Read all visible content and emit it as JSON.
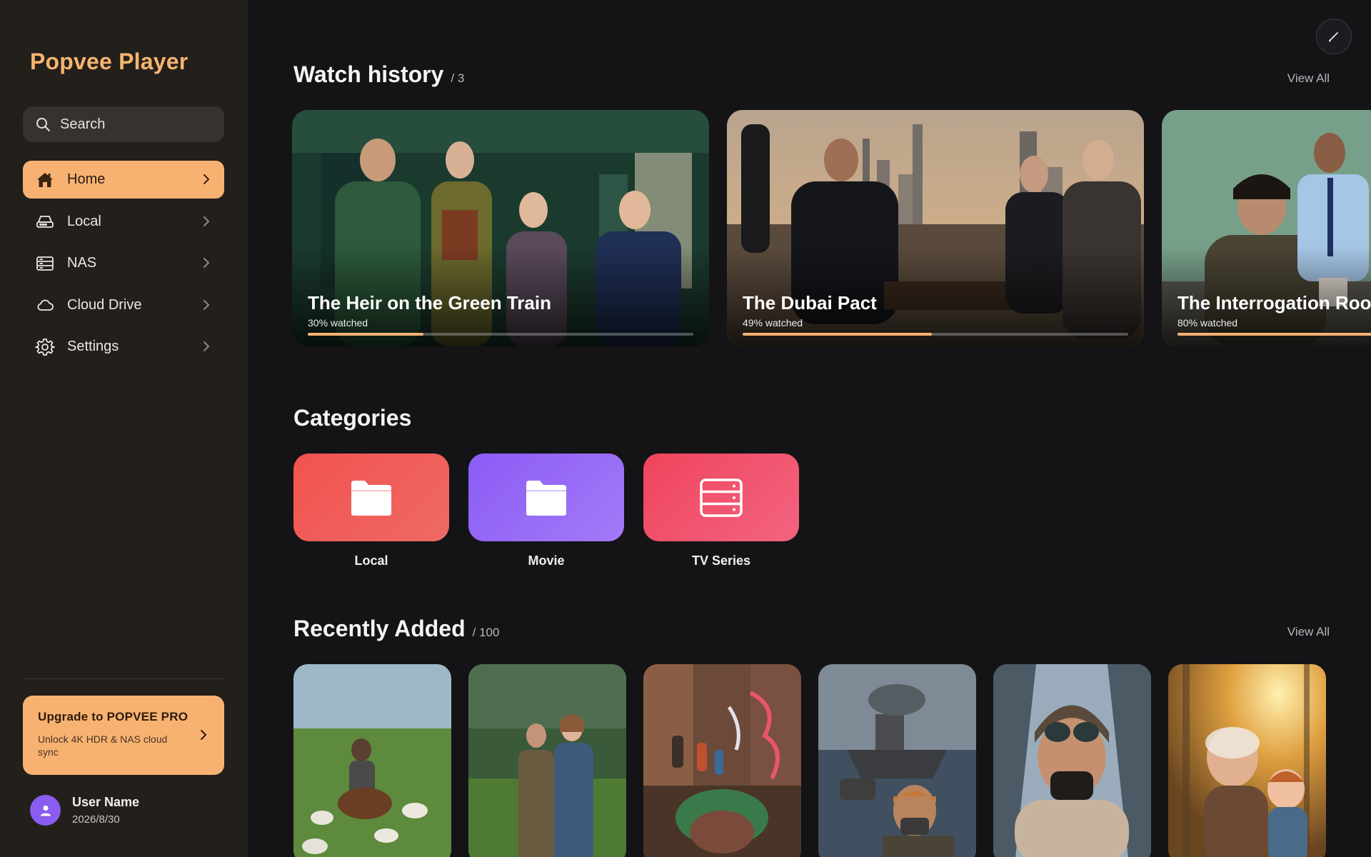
{
  "app": {
    "title": "Popvee Player"
  },
  "search": {
    "placeholder": "Search"
  },
  "sidebar": {
    "items": [
      {
        "label": "Home",
        "icon": "home-icon",
        "active": true
      },
      {
        "label": "Local",
        "icon": "hard-drive-icon",
        "active": false
      },
      {
        "label": "NAS",
        "icon": "server-icon",
        "active": false
      },
      {
        "label": "Cloud Drive",
        "icon": "cloud-icon",
        "active": false
      },
      {
        "label": "Settings",
        "icon": "gear-icon",
        "active": false
      }
    ],
    "upgrade": {
      "title": "Upgrade to POPVEE PRO",
      "subtitle": "Unlock 4K HDR & NAS cloud sync"
    },
    "user": {
      "name": "User Name",
      "date": "2026/8/30"
    }
  },
  "watch_history": {
    "title": "Watch history",
    "count": "/ 3",
    "view_all": "View All",
    "items": [
      {
        "title": "The Heir on the Green Train",
        "progress_text": "30% watched",
        "progress": 0.3
      },
      {
        "title": "The Dubai Pact",
        "progress_text": "49% watched",
        "progress": 0.49
      },
      {
        "title": "The Interrogation Room",
        "progress_text": "80% watched",
        "progress": 0.8
      }
    ]
  },
  "categories": {
    "title": "Categories",
    "items": [
      {
        "label": "Local",
        "icon": "folder-icon",
        "color_from": "#f2524f",
        "color_to": "#ee6a64"
      },
      {
        "label": "Movie",
        "icon": "folder-icon",
        "color_from": "#8b5cf6",
        "color_to": "#a27af7"
      },
      {
        "label": "TV Series",
        "icon": "server-icon",
        "color_from": "#f0445d",
        "color_to": "#f26480"
      }
    ]
  },
  "recently_added": {
    "title": "Recently Added",
    "count": "/ 100",
    "view_all": "View All",
    "items": [
      {
        "icon": "shepherd-poster"
      },
      {
        "icon": "meadow-couple-poster"
      },
      {
        "icon": "fantasy-canyon-poster"
      },
      {
        "icon": "war-ship-poster"
      },
      {
        "icon": "pilot-poster"
      },
      {
        "icon": "grandpa-child-poster"
      }
    ]
  },
  "colors": {
    "accent": "#f7b272",
    "sidebar_bg": "#231f1b",
    "main_bg": "#141316"
  }
}
